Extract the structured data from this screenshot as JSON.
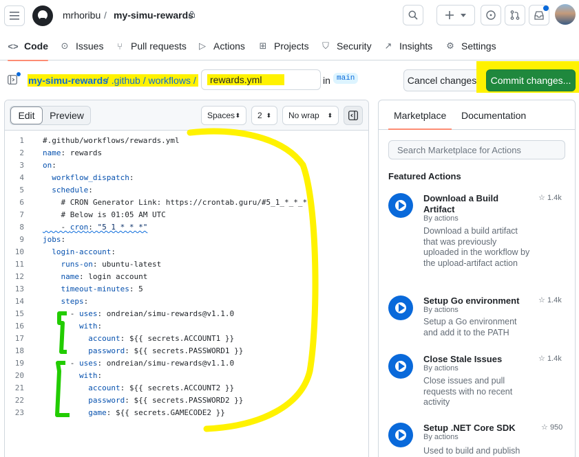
{
  "header": {
    "owner": "mrhoribu",
    "separator": "/",
    "repo": "my-simu-rewards"
  },
  "repo_nav": {
    "items": [
      {
        "label": "Code",
        "icon": "code-icon"
      },
      {
        "label": "Issues",
        "icon": "issue-icon"
      },
      {
        "label": "Pull requests",
        "icon": "pull-request-icon"
      },
      {
        "label": "Actions",
        "icon": "play-icon"
      },
      {
        "label": "Projects",
        "icon": "table-icon"
      },
      {
        "label": "Security",
        "icon": "shield-icon"
      },
      {
        "label": "Insights",
        "icon": "graph-icon"
      },
      {
        "label": "Settings",
        "icon": "gear-icon"
      }
    ]
  },
  "path": {
    "repo": "my-simu-rewards",
    "rest": "/ .github / workflows /",
    "filename": "rewards.yml",
    "in_label": "in",
    "branch": "main",
    "cancel_label": "Cancel changes",
    "commit_label": "Commit changes..."
  },
  "editor": {
    "edit_tab": "Edit",
    "preview_tab": "Preview",
    "indent_mode": "Spaces",
    "indent_size": "2",
    "wrap_mode": "No wrap",
    "lines": [
      "#.github/workflows/rewards.yml",
      "name: rewards",
      "on:",
      "  workflow_dispatch:",
      "  schedule:",
      "    # CRON Generator Link: https://crontab.guru/#5_1_*_*_*",
      "    # Below is 01:05 AM UTC",
      "    - cron: \"5 1 * * *\"",
      "jobs:",
      "  login-account:",
      "    runs-on: ubuntu-latest",
      "    name: login account",
      "    timeout-minutes: 5",
      "    steps:",
      "      - uses: ondreian/simu-rewards@v1.1.0",
      "        with:",
      "          account: ${{ secrets.ACCOUNT1 }}",
      "          password: ${{ secrets.PASSWORD1 }}",
      "      - uses: ondreian/simu-rewards@v1.1.0",
      "        with:",
      "          account: ${{ secrets.ACCOUNT2 }}",
      "          password: ${{ secrets.PASSWORD2 }}",
      "          game: ${{ secrets.GAMECODE2 }}"
    ]
  },
  "marketplace": {
    "tab_marketplace": "Marketplace",
    "tab_documentation": "Documentation",
    "search_placeholder": "Search Marketplace for Actions",
    "featured_heading": "Featured Actions",
    "actions": [
      {
        "title": "Download a Build Artifact",
        "by": "By actions",
        "stars": "1.4k",
        "description": "Download a build artifact that was previously uploaded in the workflow by the upload-artifact action"
      },
      {
        "title": "Setup Go environment",
        "by": "By actions",
        "stars": "1.4k",
        "description": "Setup a Go environment and add it to the PATH"
      },
      {
        "title": "Close Stale Issues",
        "by": "By actions",
        "stars": "1.4k",
        "description": "Close issues and pull requests with no recent activity"
      },
      {
        "title": "Setup .NET Core SDK",
        "by": "By actions",
        "stars": "950",
        "description": "Used to build and publish"
      }
    ]
  },
  "colors": {
    "highlight_yellow": "#fff200",
    "annotation_green": "#22cc00",
    "commit_green": "#1f883d",
    "link_blue": "#0969da",
    "tab_underline": "#fd8c73"
  }
}
